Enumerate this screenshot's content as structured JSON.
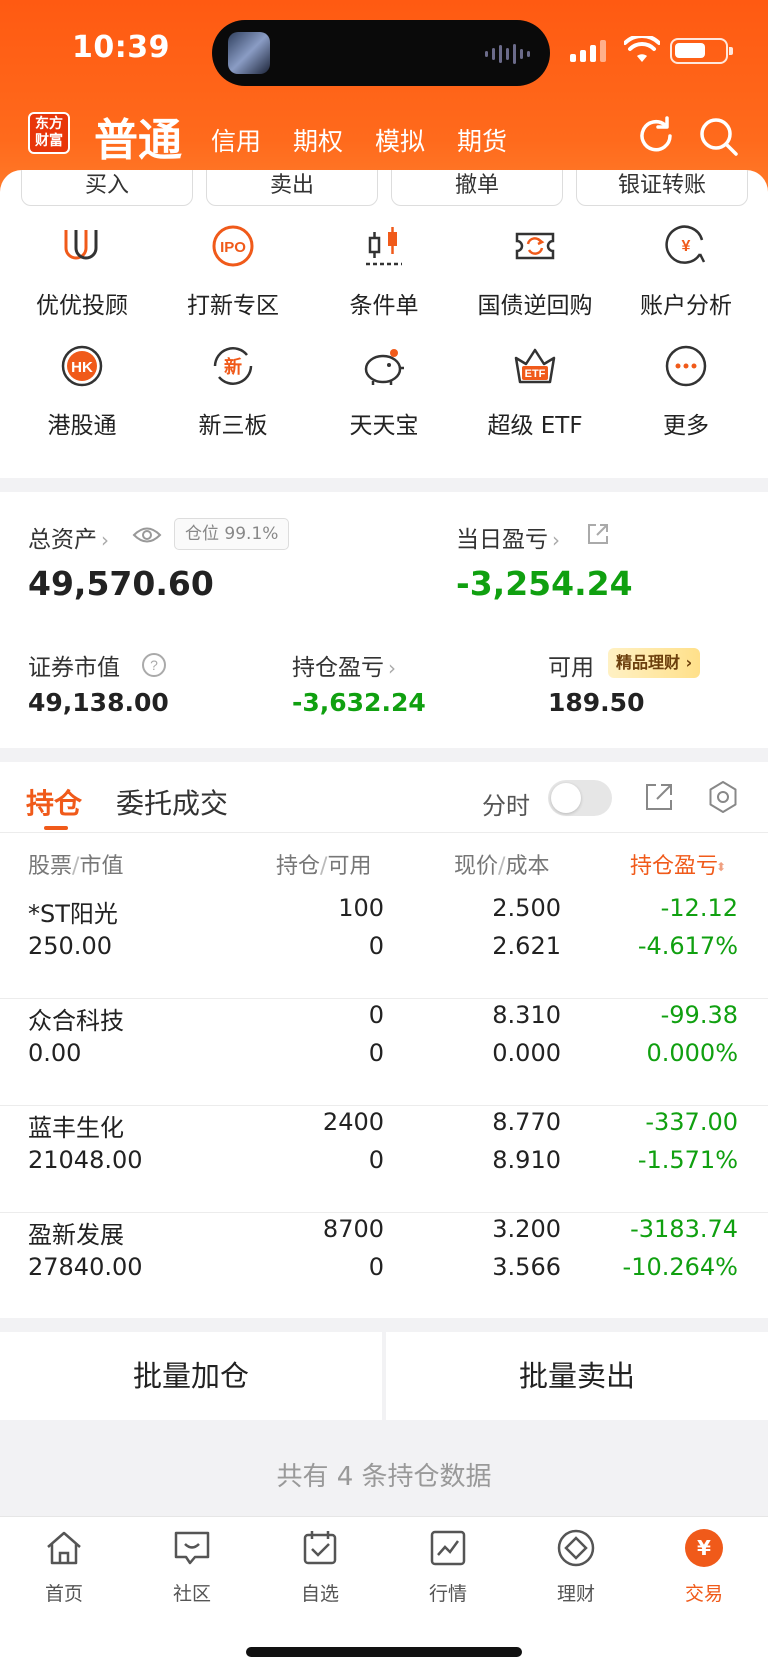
{
  "status_bar": {
    "time": "10:39"
  },
  "header": {
    "logo_line1": "东方",
    "logo_line2": "财富",
    "current_tab": "普通",
    "tabs": [
      "信用",
      "期权",
      "模拟",
      "期货"
    ]
  },
  "quick_buttons": [
    "买入",
    "卖出",
    "撤单",
    "银证转账"
  ],
  "functions": [
    {
      "label": "优优投顾",
      "icon": "youyou-icon"
    },
    {
      "label": "打新专区",
      "icon": "ipo-icon",
      "icon_text": "IPO"
    },
    {
      "label": "条件单",
      "icon": "candlestick-icon"
    },
    {
      "label": "国债逆回购",
      "icon": "repo-icon"
    },
    {
      "label": "账户分析",
      "icon": "account-analysis-icon",
      "icon_text": "¥"
    },
    {
      "label": "港股通",
      "icon": "hk-icon",
      "icon_text": "HK"
    },
    {
      "label": "新三板",
      "icon": "new-board-icon",
      "icon_text": "新"
    },
    {
      "label": "天天宝",
      "icon": "piggy-bank-icon"
    },
    {
      "label": "超级 ETF",
      "icon": "etf-icon",
      "icon_text": "ETF"
    },
    {
      "label": "更多",
      "icon": "more-icon"
    }
  ],
  "assets": {
    "total_label": "总资产",
    "position_badge": "仓位 99.1%",
    "total_value": "49,570.60",
    "daily_pl_label": "当日盈亏",
    "daily_pl_value": "-3,254.24",
    "market_value_label": "证券市值",
    "market_value": "49,138.00",
    "holding_pl_label": "持仓盈亏",
    "holding_pl_value": "-3,632.24",
    "available_label": "可用",
    "wealth_badge": "精品理财",
    "available_value": "189.50"
  },
  "holdings": {
    "tabs": [
      "持仓",
      "委托成交"
    ],
    "timeshare_label": "分时",
    "columns": {
      "stock": "股票",
      "market_value": "市值",
      "position": "持仓",
      "available": "可用",
      "price": "现价",
      "cost": "成本",
      "pl": "持仓盈亏"
    },
    "rows": [
      {
        "name": "*ST阳光",
        "value": "250.00",
        "position": "100",
        "available": "0",
        "price": "2.500",
        "cost": "2.621",
        "pl": "-12.12",
        "pl_pct": "-4.617%"
      },
      {
        "name": "众合科技",
        "value": "0.00",
        "position": "0",
        "available": "0",
        "price": "8.310",
        "cost": "0.000",
        "pl": "-99.38",
        "pl_pct": "0.000%"
      },
      {
        "name": "蓝丰生化",
        "value": "21048.00",
        "position": "2400",
        "available": "0",
        "price": "8.770",
        "cost": "8.910",
        "pl": "-337.00",
        "pl_pct": "-1.571%"
      },
      {
        "name": "盈新发展",
        "value": "27840.00",
        "position": "8700",
        "available": "0",
        "price": "3.200",
        "cost": "3.566",
        "pl": "-3183.74",
        "pl_pct": "-10.264%"
      }
    ]
  },
  "actions": {
    "batch_add": "批量加仓",
    "batch_sell": "批量卖出"
  },
  "footer_note": "共有 4 条持仓数据",
  "tabbar": [
    {
      "label": "首页",
      "icon": "home-icon"
    },
    {
      "label": "社区",
      "icon": "community-icon"
    },
    {
      "label": "自选",
      "icon": "watchlist-icon"
    },
    {
      "label": "行情",
      "icon": "market-icon"
    },
    {
      "label": "理财",
      "icon": "wealth-icon"
    },
    {
      "label": "交易",
      "icon": "trade-icon",
      "icon_text": "¥",
      "active": true
    }
  ],
  "colors": {
    "accent": "#f05a1a",
    "header": "#ff5a12",
    "loss_green": "#10a010"
  }
}
